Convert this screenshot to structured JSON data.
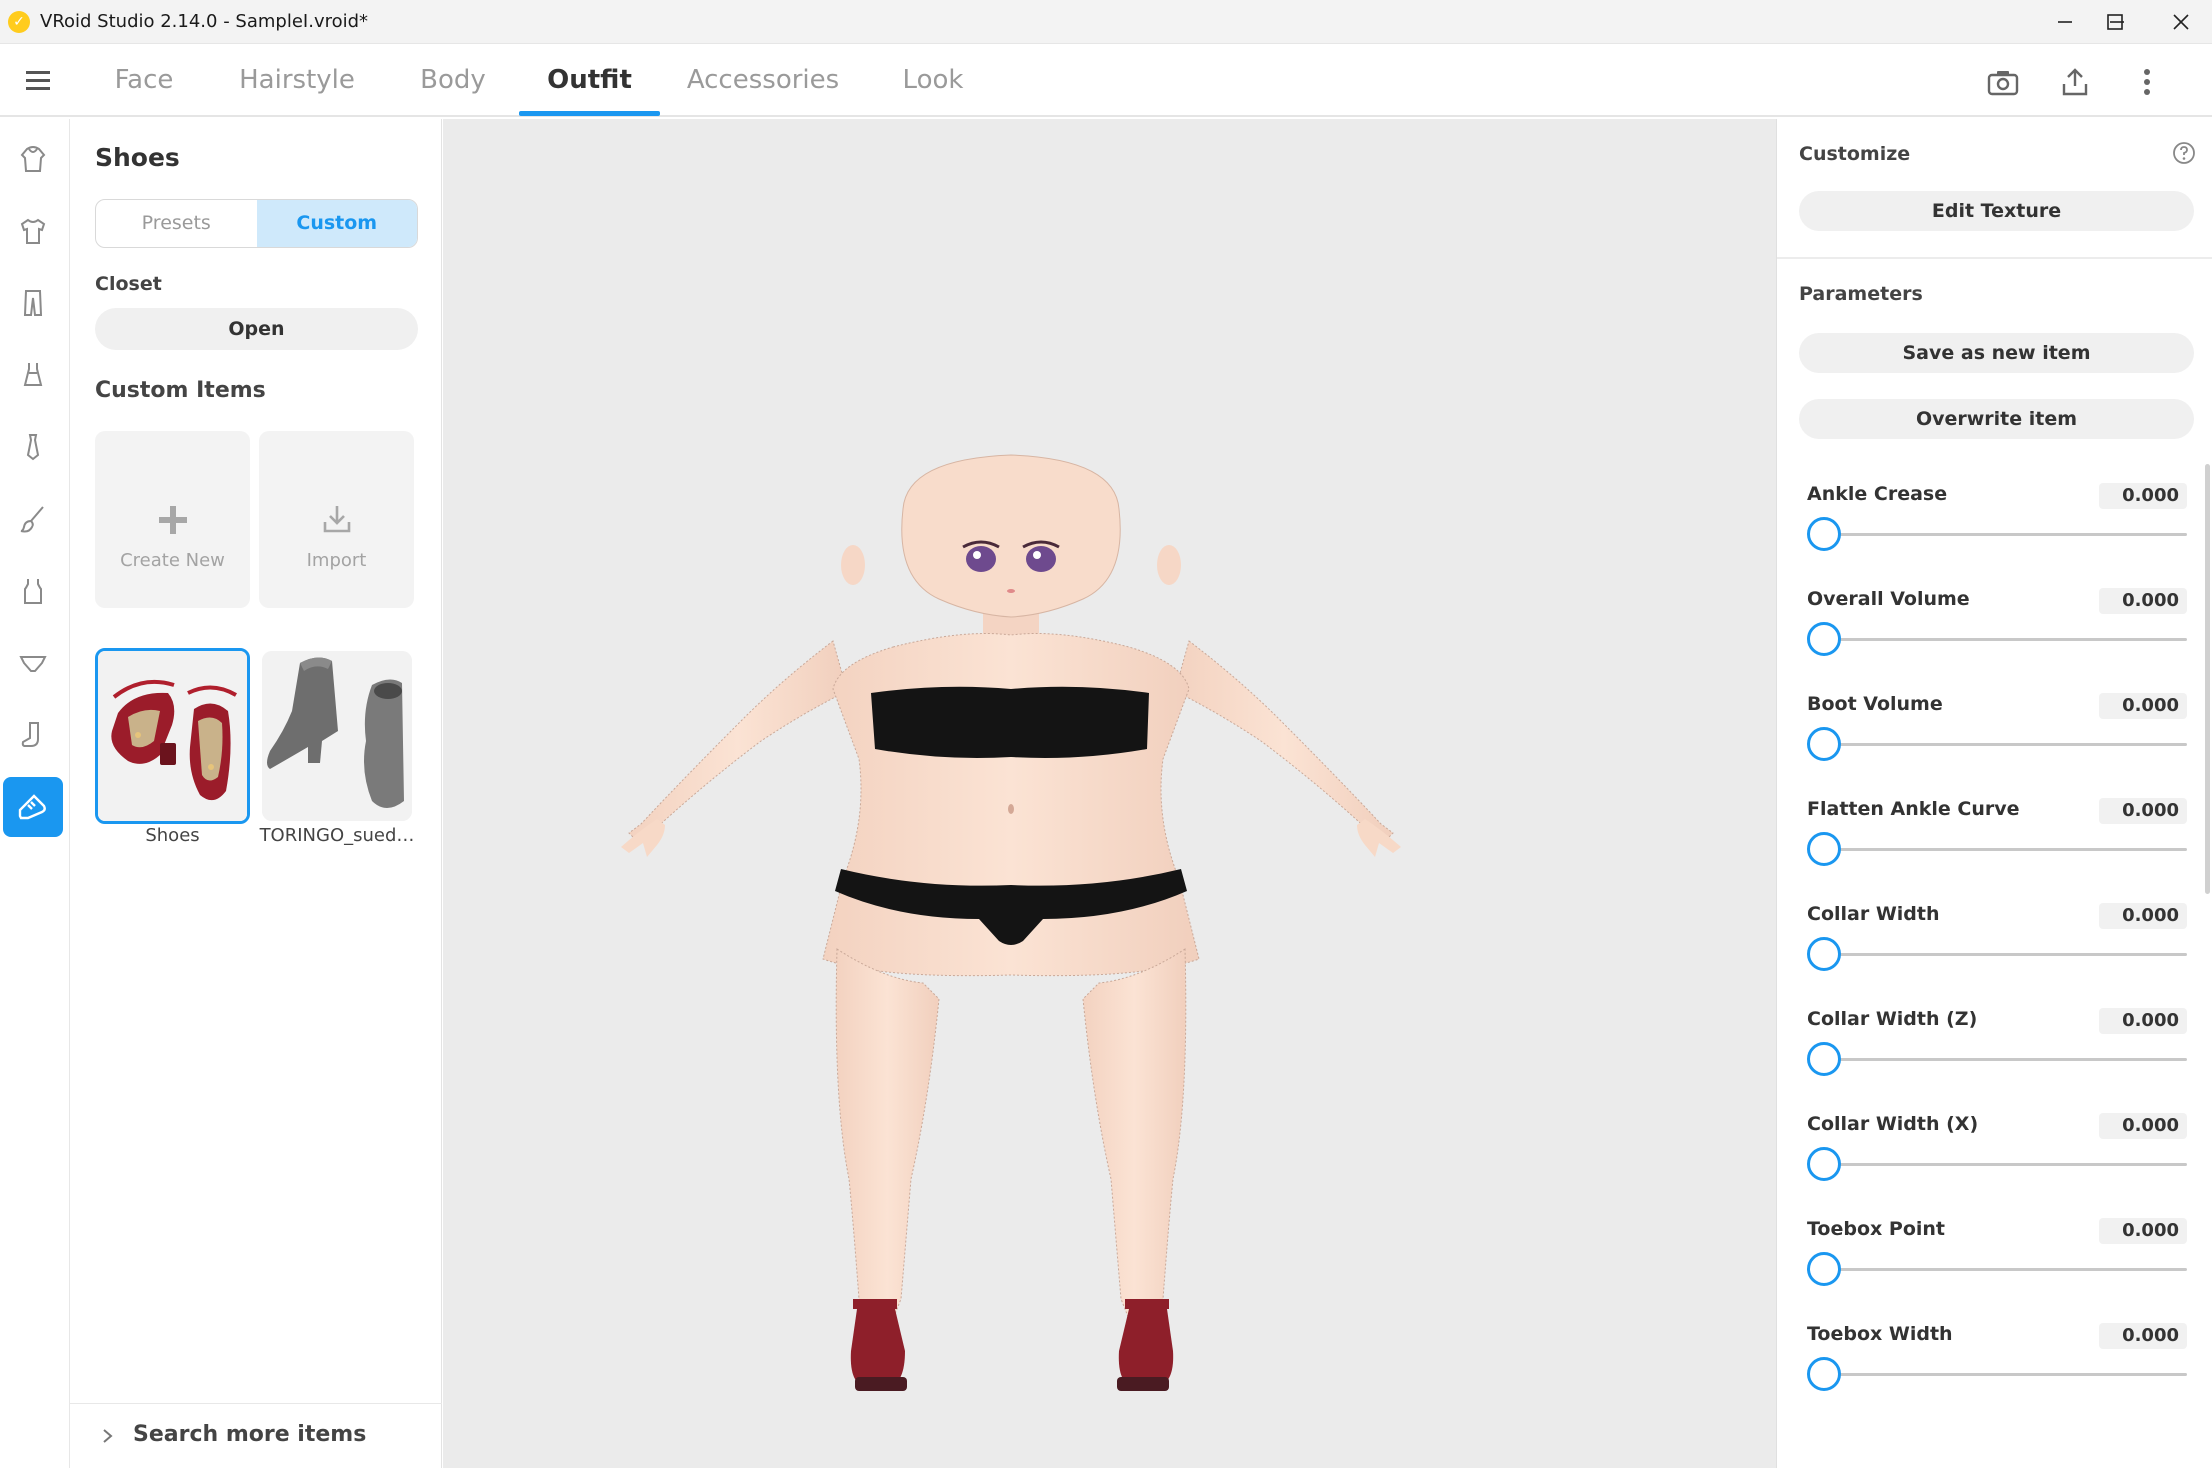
{
  "window": {
    "title": "VRoid Studio 2.14.0 - SampleI.vroid*",
    "app_icon": "vroid-logo-icon",
    "controls": [
      "minimize-icon",
      "maximize-icon",
      "close-icon"
    ]
  },
  "tabs": [
    {
      "label": "Face",
      "active": false
    },
    {
      "label": "Hairstyle",
      "active": false
    },
    {
      "label": "Body",
      "active": false
    },
    {
      "label": "Outfit",
      "active": true
    },
    {
      "label": "Accessories",
      "active": false
    },
    {
      "label": "Look",
      "active": false
    }
  ],
  "toolbar": {
    "icons": [
      "camera-icon",
      "export-icon",
      "more-vert-icon"
    ]
  },
  "rail": {
    "items": [
      {
        "icon": "hoodie-icon",
        "active": false
      },
      {
        "icon": "tshirt-icon",
        "active": false
      },
      {
        "icon": "pants-icon",
        "active": false
      },
      {
        "icon": "dress-icon",
        "active": false
      },
      {
        "icon": "tie-icon",
        "active": false
      },
      {
        "icon": "brush-icon",
        "active": false
      },
      {
        "icon": "tank-top-icon",
        "active": false
      },
      {
        "icon": "underwear-icon",
        "active": false
      },
      {
        "icon": "sock-icon",
        "active": false
      },
      {
        "icon": "shoe-icon",
        "active": true
      }
    ]
  },
  "items_panel": {
    "title": "Shoes",
    "segments": [
      {
        "label": "Presets",
        "active": false
      },
      {
        "label": "Custom",
        "active": true
      }
    ],
    "closet_label": "Closet",
    "closet_button": "Open",
    "custom_items_title": "Custom Items",
    "create_new_label": "Create New",
    "import_label": "Import",
    "items": [
      {
        "label": "Shoes",
        "selected": true
      },
      {
        "label": "TORINGO_sued…",
        "selected": false
      }
    ],
    "search_more": "Search more items"
  },
  "right_panel": {
    "customize_label": "Customize",
    "edit_texture": "Edit Texture",
    "parameters_label": "Parameters",
    "save_new": "Save as new item",
    "overwrite": "Overwrite item",
    "params": [
      {
        "name": "Ankle Crease",
        "value": "0.000",
        "level": 0
      },
      {
        "name": "Overall Volume",
        "value": "0.000",
        "level": 0
      },
      {
        "name": "Boot Volume",
        "value": "0.000",
        "level": 0
      },
      {
        "name": "Flatten Ankle Curve",
        "value": "0.000",
        "level": 0
      },
      {
        "name": "Collar Width",
        "value": "0.000",
        "level": 0
      },
      {
        "name": "Collar Width (Z)",
        "value": "0.000",
        "level": 0
      },
      {
        "name": "Collar Width (X)",
        "value": "0.000",
        "level": 0
      },
      {
        "name": "Toebox Point",
        "value": "0.000",
        "level": 0
      },
      {
        "name": "Toebox Width",
        "value": "0.000",
        "level": 0
      }
    ]
  },
  "colors": {
    "accent": "#1a97f0",
    "viewport_bg": "#ebebeb",
    "skin": "#f8dccb",
    "shoe_red": "#8e1f2a",
    "garment": "#141414"
  }
}
